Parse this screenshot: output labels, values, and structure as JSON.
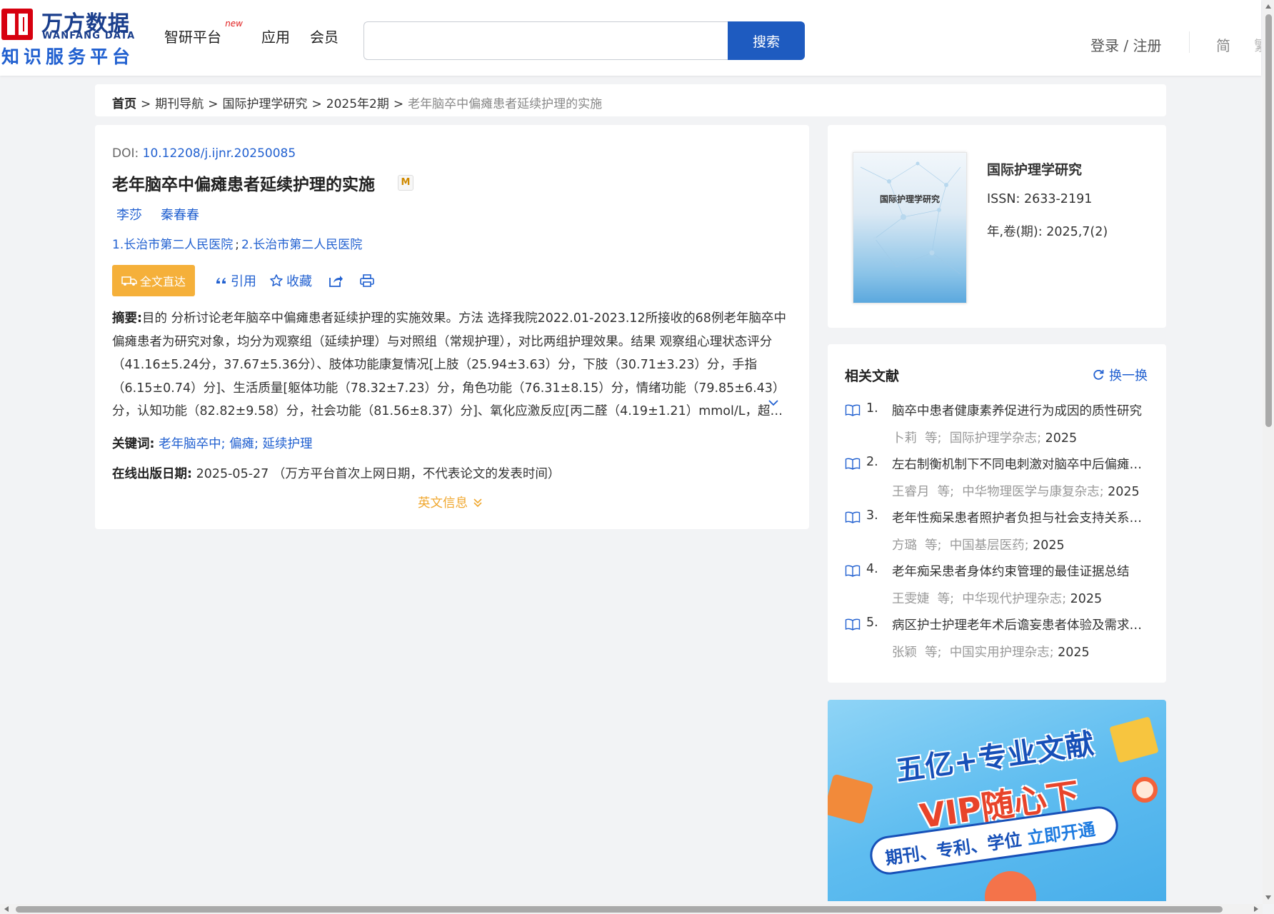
{
  "header": {
    "logo_cn": "万方数据",
    "logo_en": "WANFANG DATA",
    "logo_sub": "知识服务平台",
    "nav": [
      {
        "label": "智研平台",
        "badge": "new"
      },
      {
        "label": "应用"
      },
      {
        "label": "会员"
      }
    ],
    "search_value": "",
    "search_button": "搜索",
    "login": "登录 / 注册",
    "lang_simplified": "简",
    "lang_traditional": "繁"
  },
  "breadcrumb": {
    "home": "首页",
    "items": [
      "期刊导航",
      "国际护理学研究",
      "2025年2期"
    ],
    "current": "老年脑卒中偏瘫患者延续护理的实施",
    "separator": ">"
  },
  "article": {
    "doi_label": "DOI: ",
    "doi": "10.12208/j.ijnr.20250085",
    "title": "老年脑卒中偏瘫患者延续护理的实施",
    "title_badge": "M",
    "authors": [
      "李莎",
      "秦春春"
    ],
    "affiliations": [
      "1.长治市第二人民医院",
      "2.长治市第二人民医院"
    ],
    "affil_sep": ";",
    "actions": {
      "fulltext": "全文直达",
      "cite": "引用",
      "favorite": "收藏"
    },
    "abstract_label": "摘要:",
    "abstract": "目的 分析讨论老年脑卒中偏瘫患者延续护理的实施效果。方法 选择我院2022.01-2023.12所接收的68例老年脑卒中偏瘫患者为研究对象，均分为观察组（延续护理）与对照组（常规护理），对比两组护理效果。结果 观察组心理状态评分（41.16±5.24分，37.67±5.36分）、肢体功能康复情况[上肢（25.94±3.63）分，下肢（30.71±3.23）分，手指（6.15±0.74）分]、生活质量[躯体功能（78.32±7.23）分，角色功能（76.31±8.15）分，情绪功能（79.85±6.43）分，认知功能（82.82±9.58）分，社会功能（81.56±8.37）分]、氧化应激反应[丙二醛（4.19±1.21）mmol/L，超氧化物...",
    "keywords_label": "关键词:",
    "keywords": [
      "老年脑卒中",
      "偏瘫",
      "延续护理"
    ],
    "keyword_sep": ";",
    "pubdate_label": "在线出版日期:",
    "pubdate": "2025-05-27",
    "pubdate_note": "（万方平台首次上网日期，不代表论文的发表时间）",
    "en_info": "英文信息"
  },
  "journal": {
    "cover_title": "国际护理学研究",
    "name": "国际护理学研究",
    "issn_label": "ISSN:",
    "issn": "2633-2191",
    "vol_label": "年,卷(期):",
    "vol": "2025,7(2)"
  },
  "related": {
    "title": "相关文献",
    "refresh": "换一换",
    "items": [
      {
        "num": "1.",
        "title": "脑卒中患者健康素养促进行为成因的质性研究",
        "author": "卜莉",
        "etal": "等;",
        "source": "国际护理学杂志",
        "year": "2025"
      },
      {
        "num": "2.",
        "title": "左右制衡机制下不同电刺激对脑卒中后偏瘫患者的影响",
        "author": "王睿月",
        "etal": "等;",
        "source": "中华物理医学与康复杂志",
        "year": "2025"
      },
      {
        "num": "3.",
        "title": "老年性痴呆患者照护者负担与社会支持关系研究",
        "author": "方璐",
        "etal": "等;",
        "source": "中国基层医药",
        "year": "2025"
      },
      {
        "num": "4.",
        "title": "老年痴呆患者身体约束管理的最佳证据总结",
        "author": "王雯婕",
        "etal": "等;",
        "source": "中华现代护理杂志",
        "year": "2025"
      },
      {
        "num": "5.",
        "title": "病区护士护理老年术后谵妄患者体验及需求的质性研究",
        "author": "张颖",
        "etal": "等;",
        "source": "中国实用护理杂志",
        "year": "2025"
      }
    ]
  },
  "banner": {
    "line1": "五亿+专业文献",
    "line2": "VIP随心下",
    "line3a": "期刊、专利、学位",
    "line3b": "立即开通"
  }
}
